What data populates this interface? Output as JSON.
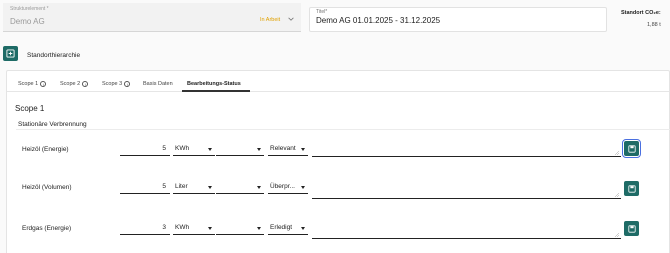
{
  "header": {
    "struktur_label": "Strukturelement *",
    "struktur_value": "Demo AG",
    "struktur_status": "In Arbeit",
    "titel_label": "Titel*",
    "titel_value": "Demo AG 01.01.2025 - 31.12.2025",
    "co2_label": "Standort CO₂e:",
    "co2_value": "1,88 t"
  },
  "hierarchy": {
    "label": "Standorthierarchie"
  },
  "tabs": [
    {
      "label": "Scope 1",
      "info": true
    },
    {
      "label": "Scope 2",
      "info": true
    },
    {
      "label": "Scope 3",
      "info": true
    },
    {
      "label": "Basis Daten",
      "info": false
    },
    {
      "label": "Bearbeitungs-Status",
      "info": false,
      "active": true
    }
  ],
  "scope_title": "Scope 1",
  "section_title": "Stationäre Verbrennung",
  "rows": [
    {
      "label": "Heizöl (Energie)",
      "value": "5",
      "unit": "KWh",
      "select2": "",
      "status": "Relevant"
    },
    {
      "label": "Heizöl (Volumen)",
      "value": "5",
      "unit": "Liter",
      "select2": "",
      "status": "Überpr..."
    },
    {
      "label": "Erdgas (Energie)",
      "value": "3",
      "unit": "KWh",
      "select2": "",
      "status": "Erledigt"
    }
  ],
  "colors": {
    "accent": "#1e6b66",
    "status_warning": "#e0a100",
    "focus": "#4a6fe0"
  }
}
